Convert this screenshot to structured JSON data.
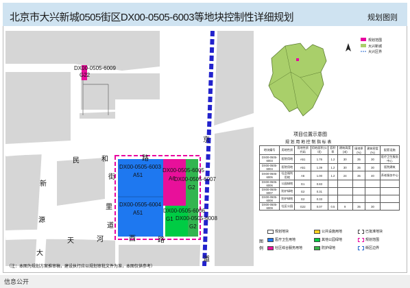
{
  "header": {
    "title": "北京市大兴新城0505街区DX00-0505-6003等地块控制性详细规划",
    "doc_type": "规划图则"
  },
  "map": {
    "lots": [
      {
        "code": "DX00-0505-6009",
        "use": "G22"
      },
      {
        "code": "DX00-0505-6003",
        "use": "A51"
      },
      {
        "code": "DX00-0505-6005",
        "use": "A6"
      },
      {
        "code": "DX00-0505-6007",
        "use": "G2"
      },
      {
        "code": "DX00-0505-6004",
        "use": "A51"
      },
      {
        "code": "DX00-0505-6006",
        "use": "G1"
      },
      {
        "code": "DX00-0505-6008",
        "use": "G2"
      }
    ],
    "road_labels": {
      "minhe_1": "民",
      "minhe_2": "和",
      "minhe_3": "路",
      "xinyuan_1": "新",
      "xinyuan_2": "源",
      "xinyuan_3": "大",
      "tianhe_1": "天",
      "tianhe_2": "河",
      "tianhe_3": "西",
      "tianhe_4": "路",
      "v_1": "街",
      "v_2": "里",
      "v_3": "道",
      "e_1": "京",
      "e_2": "道"
    },
    "note": "（注：本图为规划方案推审稿，建设执行应以规划审批文件为准，本图仅供参考）"
  },
  "location_map": {
    "legend": [
      "规划范围",
      "大兴新城",
      "大兴区界"
    ],
    "title": "项目位置示意图"
  },
  "control_table": {
    "title": "规 划 用 地 控 制 指 标 表",
    "columns": [
      "地块编号",
      "用地性质",
      "用地性质代码",
      "用地面积(公顷)",
      "容积率",
      "建筑高度(米)",
      "绿地率(%)",
      "建筑密度(%)",
      "配套设施"
    ],
    "rows": [
      [
        "DX00-0505-6003",
        "医院用地",
        "A51",
        "1.76",
        "1.2",
        "30",
        "35",
        "30",
        "医疗卫生服务中心"
      ],
      [
        "DX00-0505-6004",
        "医院用地",
        "A51",
        "1.39",
        "1.2",
        "30",
        "35",
        "30",
        "医院建筑"
      ],
      [
        "DX00-0505-6005",
        "社会福利用地",
        "A6",
        "1.00",
        "1.2",
        "24",
        "35",
        "40",
        "养老服务中心"
      ],
      [
        "DX00-0505-6006",
        "公园绿地",
        "G1",
        "0.83",
        "",
        "",
        "",
        "",
        ""
      ],
      [
        "DX00-0505-6007",
        "防护绿地",
        "G2",
        "0.31",
        "",
        "",
        "",
        "",
        ""
      ],
      [
        "DX00-0505-6008",
        "防护绿地",
        "G2",
        "0.33",
        "",
        "",
        "",
        "",
        ""
      ],
      [
        "DX00-0505-6009",
        "社区公园",
        "G22",
        "0.07",
        "0.5",
        "9",
        "35",
        "30",
        ""
      ]
    ]
  },
  "legend": {
    "title_1": "图",
    "title_2": "例",
    "items": [
      {
        "label": "规划地块",
        "color": "#ffffff"
      },
      {
        "label": "公共设施用地",
        "color": "#ffd21f"
      },
      {
        "label": "已批准地块",
        "color": "#ffffff"
      },
      {
        "label": "医疗卫生用地",
        "color": "#1e78f0"
      },
      {
        "label": "其他公园绿地",
        "color": "#00cc44"
      },
      {
        "label": "规划范围",
        "color": "#ffffff"
      },
      {
        "label": "社区综合服务用地",
        "color": "#e8109a"
      },
      {
        "label": "防护绿地",
        "color": "#39b54a"
      },
      {
        "label": "街区边界",
        "color": "#ffffff"
      }
    ]
  },
  "footer": {
    "text": "信息公开"
  },
  "colors": {
    "medical": "#1e78f0",
    "welfare": "#e8109a",
    "park": "#00cc44",
    "protect": "#32b550",
    "rail": "#2222cc",
    "boundary": "#e800a0",
    "header": "#cfe3f1"
  }
}
